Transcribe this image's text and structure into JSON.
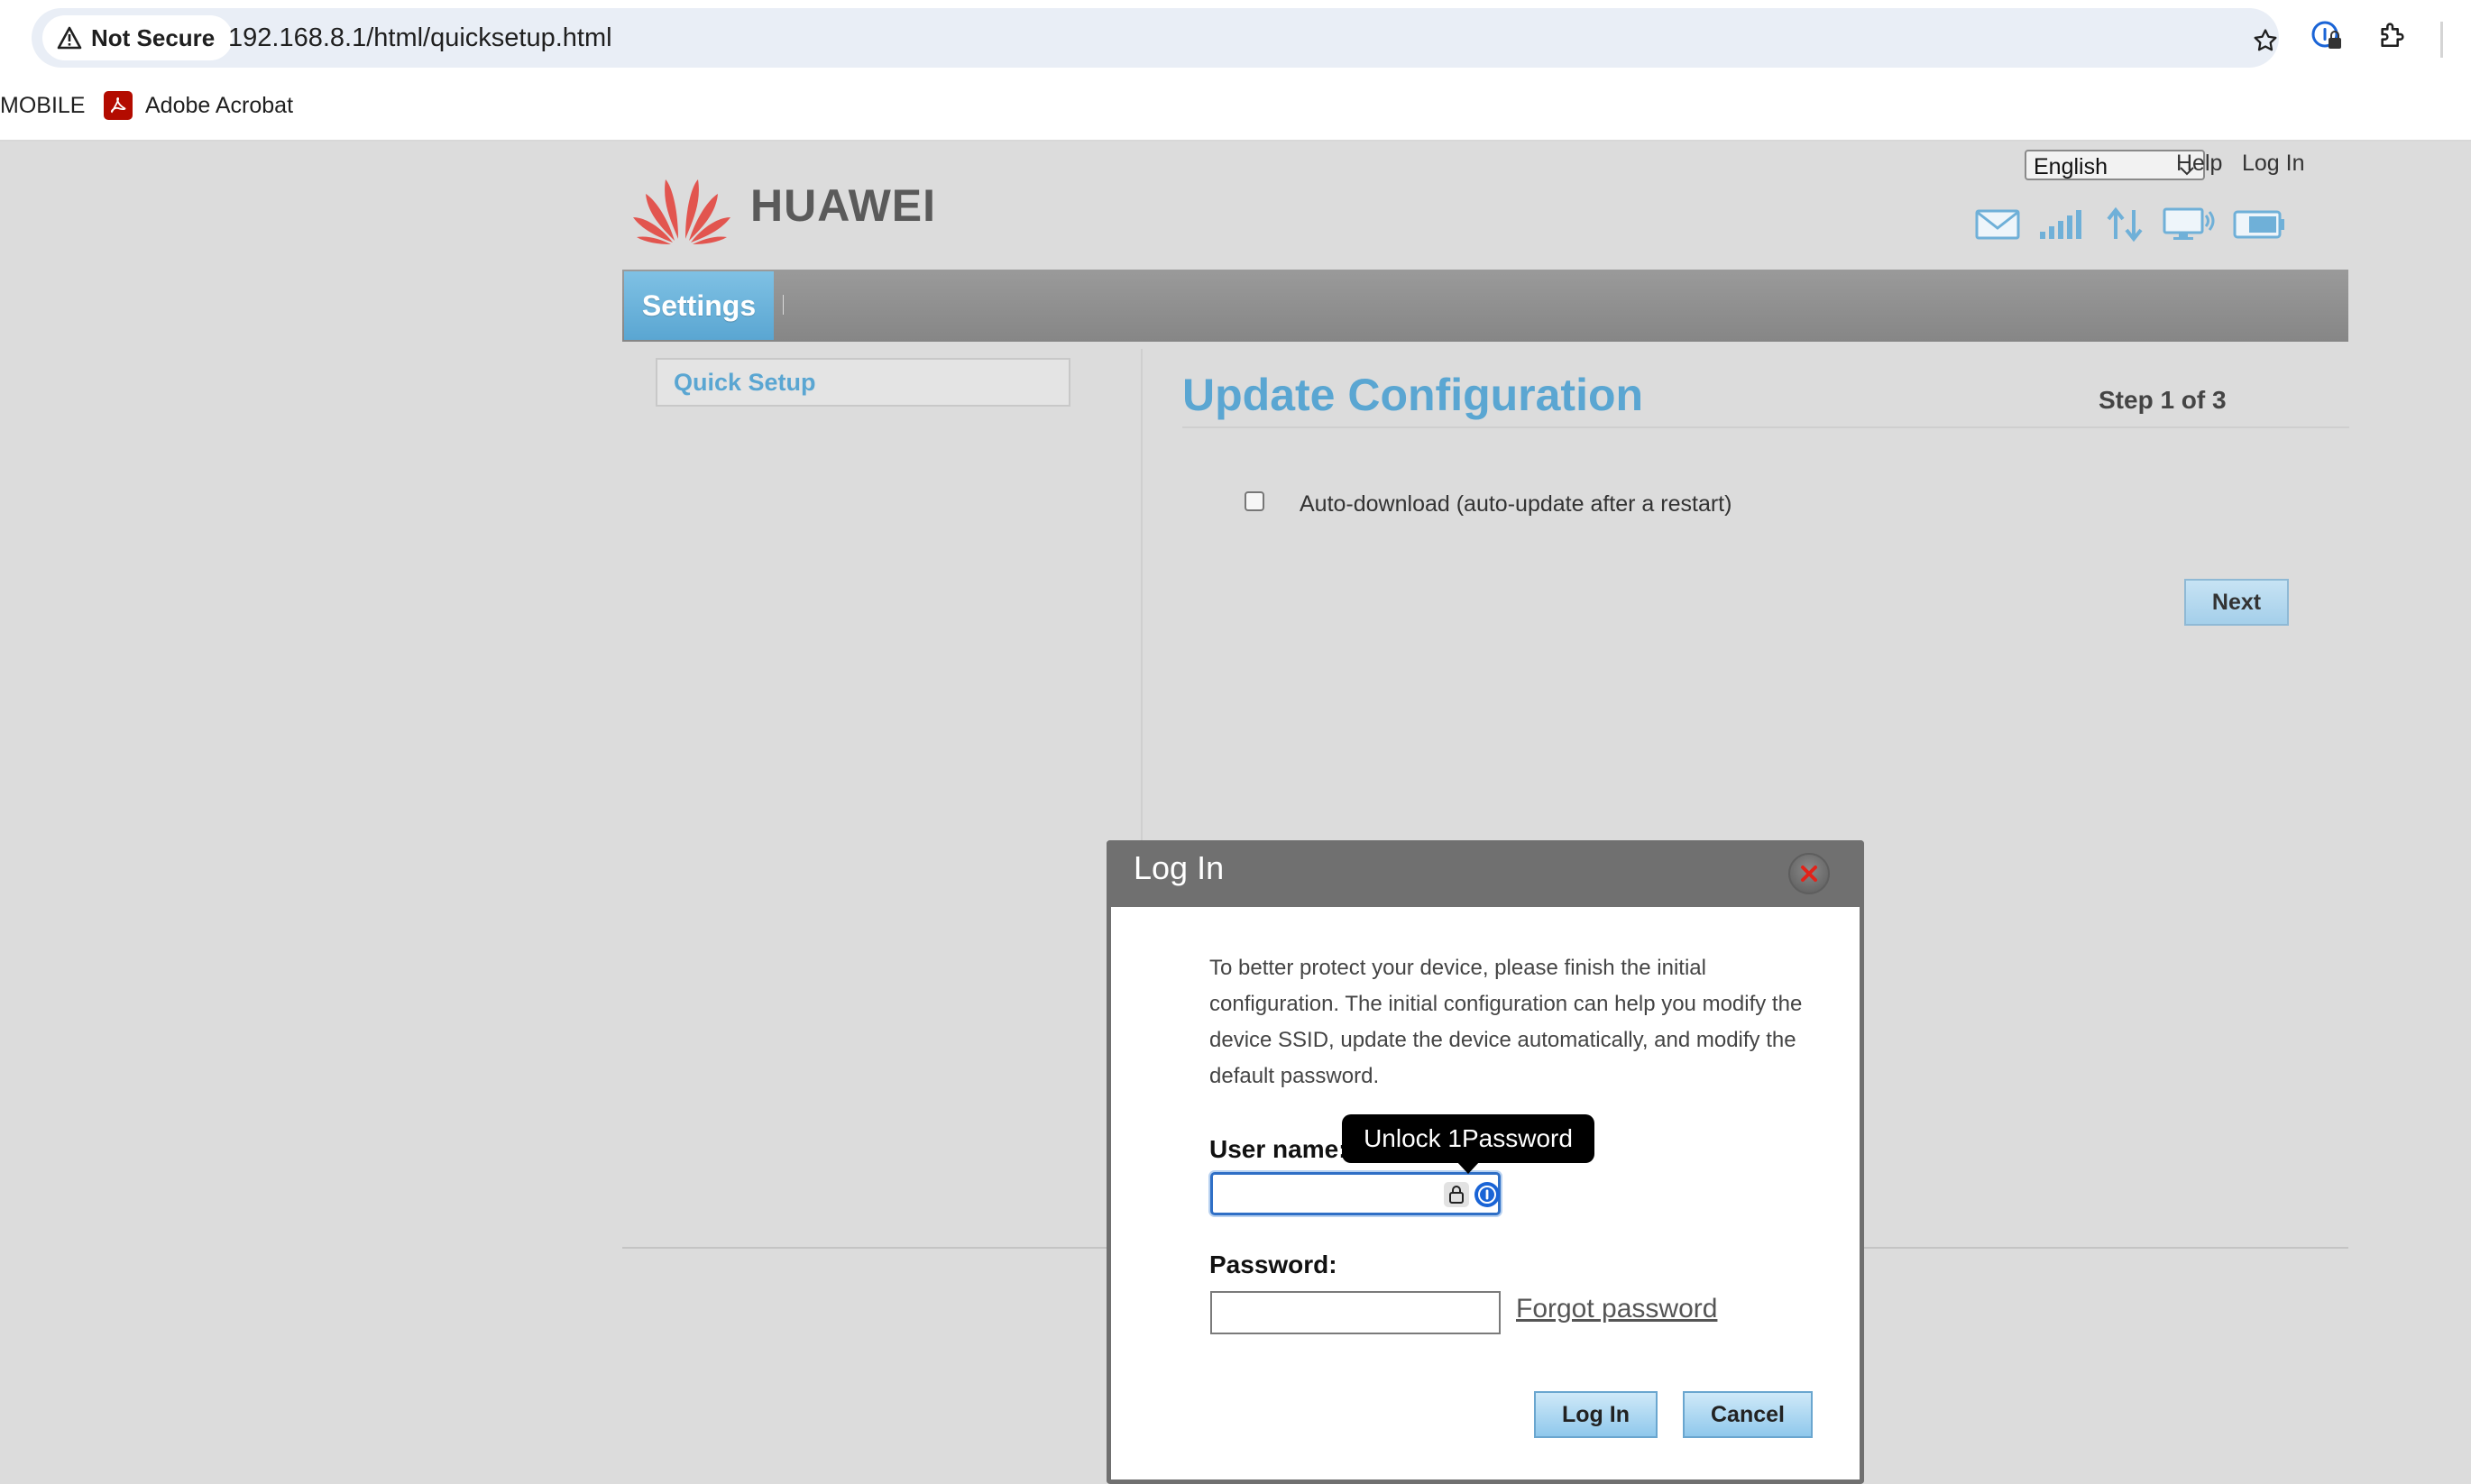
{
  "browser": {
    "security_label": "Not Secure",
    "url": "192.168.8.1/html/quicksetup.html",
    "bookmarks": [
      "MOBILE",
      "Adobe Acrobat"
    ],
    "icons": [
      "warning-icon",
      "star-icon",
      "1password-extension-icon",
      "extensions-icon"
    ]
  },
  "header": {
    "logo_text": "HUAWEI",
    "language_selected": "English",
    "links": {
      "help": "Help",
      "login": "Log In"
    },
    "status_icons": [
      "mail-icon",
      "signal-icon",
      "data-transfer-icon",
      "device-icon",
      "battery-icon"
    ]
  },
  "nav": {
    "tabs": [
      {
        "label": "Settings",
        "active": true
      }
    ]
  },
  "sidebar": {
    "items": [
      {
        "label": "Quick Setup"
      }
    ]
  },
  "main": {
    "title": "Update Configuration",
    "step": "Step 1 of 3",
    "auto_download_label": "Auto-download (auto-update after a restart)",
    "auto_download_checked": false,
    "next_label": "Next"
  },
  "login_dialog": {
    "title": "Log In",
    "message": "To better protect your device, please finish the initial configuration. The initial configuration can help you modify the device SSID, update the device automatically, and modify the default password.",
    "username_label": "User name:",
    "username_value": "",
    "password_label": "Password:",
    "password_value": "",
    "forgot_label": "Forgot password",
    "login_button": "Log In",
    "cancel_button": "Cancel",
    "tooltip": "Unlock 1Password"
  },
  "colors": {
    "accent": "#5aa6d2",
    "page_bg": "#dcdcdc",
    "navbar": "#8c8c8c",
    "dialog_header": "#707070",
    "huawei_red": "#e2554f"
  }
}
